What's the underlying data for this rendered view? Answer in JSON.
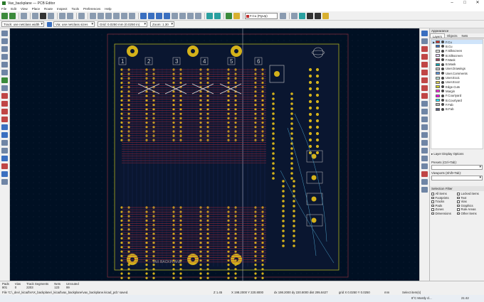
{
  "window": {
    "title": "Vax_backplane — PCB Editor",
    "minimize": "–",
    "maximize": "□",
    "close": "✕"
  },
  "menu": [
    "File",
    "Edit",
    "View",
    "Place",
    "Route",
    "Inspect",
    "Tools",
    "Preferences",
    "Help"
  ],
  "toolbar": {
    "layer_selector": "F.Cu (PgUp)"
  },
  "options": {
    "track_width": "Track: use netclass width",
    "via_size": "Via: use netclass sizes",
    "grid": "Grid: 0.0250 mm (0.0250 in)",
    "zoom": "Zoom: 1.30"
  },
  "board": {
    "slot_numbers": [
      "1",
      "2",
      "3",
      "4",
      "5",
      "6"
    ],
    "silk_text": "VAX BACKPLANE"
  },
  "panel": {
    "title": "Appearance",
    "tabs": [
      "Layers",
      "Objects",
      "Nets"
    ],
    "layers": [
      {
        "name": "F.Cu",
        "color": "#c83030",
        "selected": true
      },
      {
        "name": "B.Cu",
        "color": "#3a6fc0"
      },
      {
        "name": "F.Silkscreen",
        "color": "#e0e0e0"
      },
      {
        "name": "B.Silkscreen",
        "color": "#e6d2ff"
      },
      {
        "name": "F.Mask",
        "color": "#a0405c"
      },
      {
        "name": "B.Mask",
        "color": "#06a3b0"
      },
      {
        "name": "User.Drawings",
        "color": "#c2c2c2"
      },
      {
        "name": "User.Comments",
        "color": "#5994dc"
      },
      {
        "name": "User.Eco1",
        "color": "#b4dbd2"
      },
      {
        "name": "User.Eco2",
        "color": "#d8c852"
      },
      {
        "name": "Edge.Cuts",
        "color": "#d0d21a"
      },
      {
        "name": "Margin",
        "color": "#ff26e2"
      },
      {
        "name": "F.Courtyard",
        "color": "#ff00f0"
      },
      {
        "name": "B.Courtyard",
        "color": "#26e9ff"
      },
      {
        "name": "F.Fab",
        "color": "#afafaf"
      },
      {
        "name": "B.Fab",
        "color": "#585d84"
      }
    ],
    "layer_options": "▸ Layer Display Options",
    "presets_label": "Presets (Ctrl+Tab):",
    "viewports_label": "Viewports (Shift+Tab):",
    "selection_filter": {
      "title": "Selection Filter",
      "items": [
        "All items",
        "Locked items",
        "Footprints",
        "Text",
        "Tracks",
        "Vias",
        "Pads",
        "Graphics",
        "Zones",
        "Rule Areas",
        "Dimensions",
        "Other items"
      ]
    }
  },
  "status": {
    "cells": [
      {
        "label": "Pads",
        "value": "801"
      },
      {
        "label": "Vias",
        "value": "0"
      },
      {
        "label": "Track Segments",
        "value": "2203"
      },
      {
        "label": "Nets",
        "value": "123"
      },
      {
        "label": "Unrouted",
        "value": "99"
      }
    ],
    "file": "File 'C:\\_dev\\_kicad\\VAX_backplane\\_kicad\\vax_backplane\\vax_backplane.kicad_pcb' saved.",
    "zoom": "Z 1.45",
    "xy": "X 198.2000  Y 220.8000",
    "dxy": "dx 198.2000  dy 220.8000  dist 295.8427",
    "grid": "grid X 0.0250  Y 0.0250",
    "units": "mm",
    "select": "Select item(s)"
  },
  "taskbar": {
    "weather": "8°C  Mostly cl...",
    "time": "21:42"
  }
}
